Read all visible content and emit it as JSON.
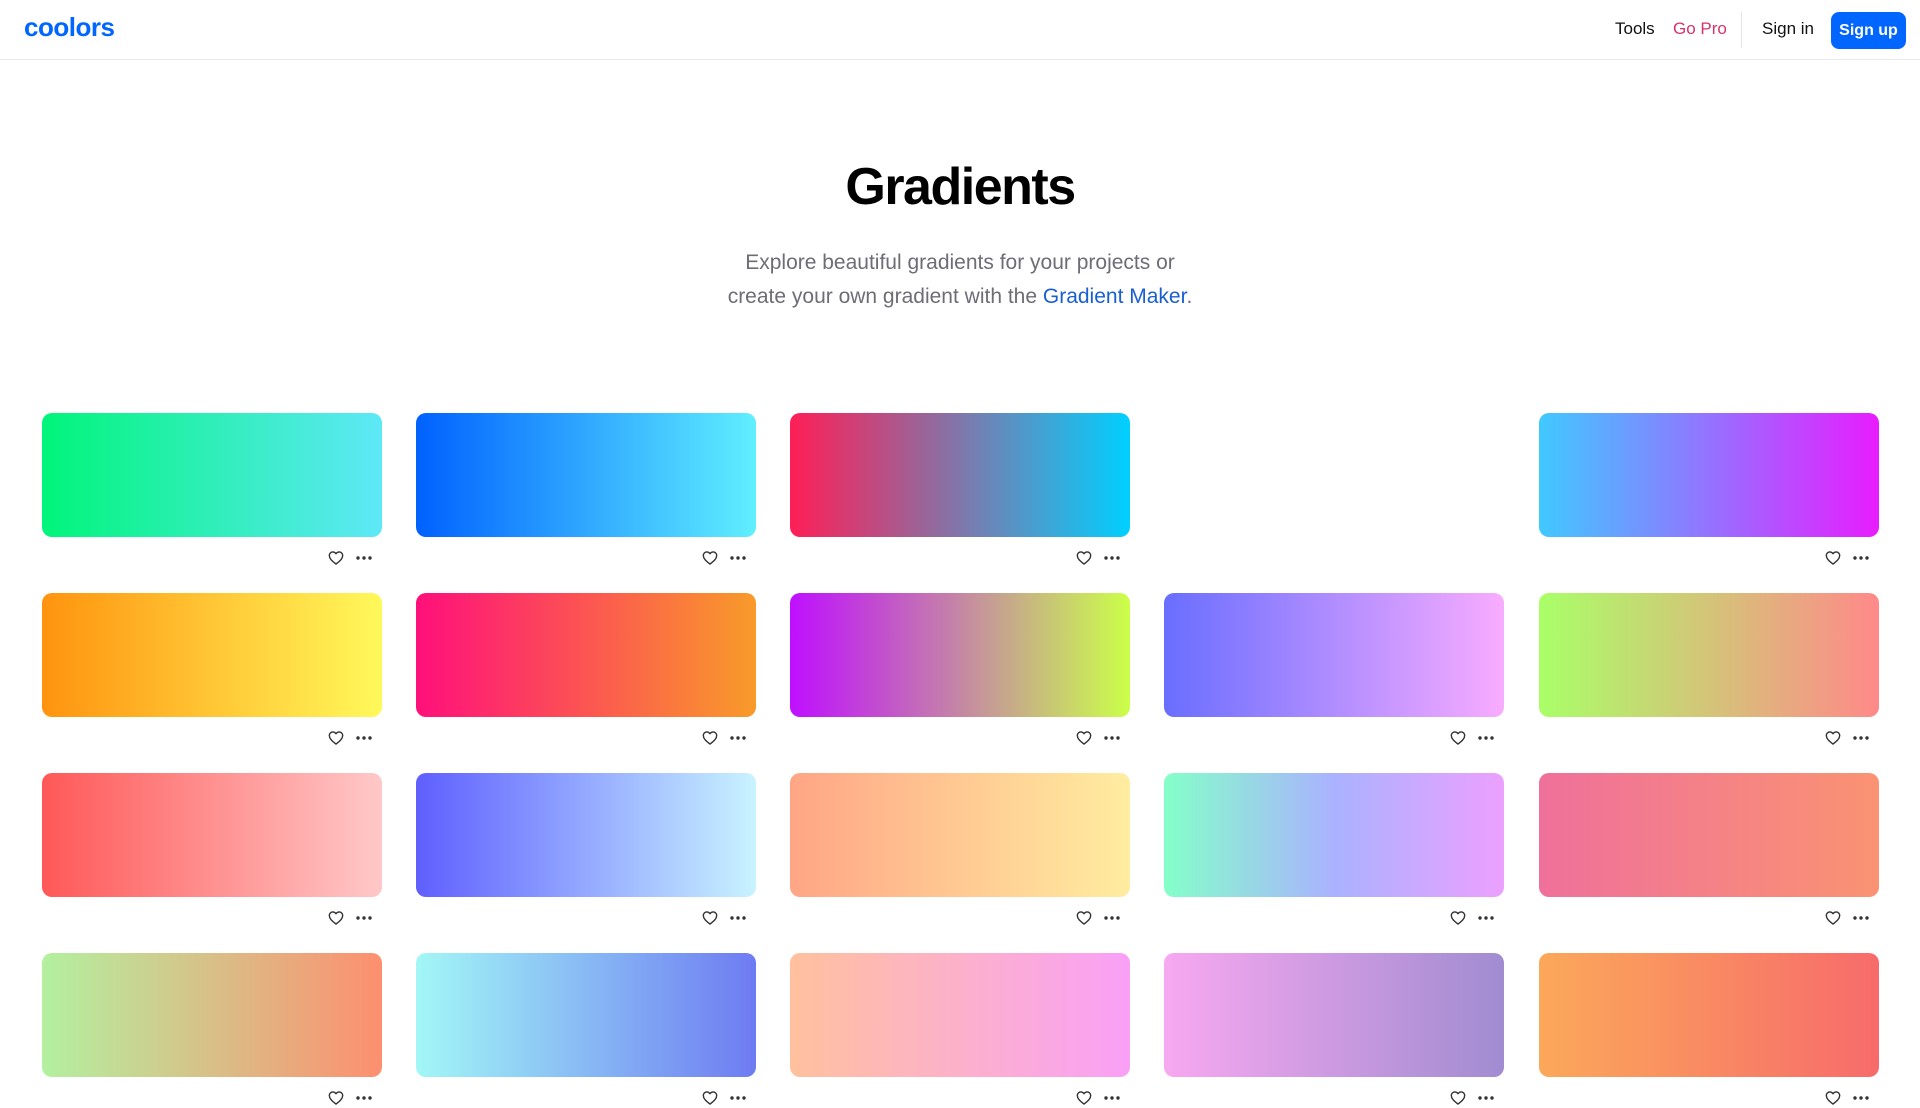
{
  "header": {
    "logo": "coolors",
    "nav": {
      "tools": "Tools",
      "go_pro": "Go Pro",
      "sign_in": "Sign in",
      "sign_up": "Sign up"
    }
  },
  "hero": {
    "title": "Gradients",
    "subtitle_line1": "Explore beautiful gradients for your projects or",
    "subtitle_line2_prefix": "create your own gradient with the ",
    "subtitle_link": "Gradient Maker",
    "subtitle_line2_suffix": "."
  },
  "gradients": [
    {
      "colors": [
        "#00f57a",
        "#5ee8f7"
      ]
    },
    {
      "colors": [
        "#0061ff",
        "#60efff"
      ]
    },
    {
      "colors": [
        "#ff1e56",
        "#00d0ff"
      ]
    },
    null,
    {
      "colors": [
        "#40c9ff",
        "#e81cff"
      ]
    },
    {
      "colors": [
        "#ff930f",
        "#fff95b"
      ]
    },
    {
      "colors": [
        "#ff0f7b",
        "#f89b29"
      ]
    },
    {
      "colors": [
        "#bf0fff",
        "#cbff49"
      ]
    },
    {
      "colors": [
        "#696eff",
        "#f8acff"
      ]
    },
    {
      "colors": [
        "#a9ff68",
        "#ff8989"
      ]
    },
    {
      "colors": [
        "#ff5858",
        "#ffc8c8"
      ]
    },
    {
      "colors": [
        "#5f5fff",
        "#c9f3ff"
      ]
    },
    {
      "colors": [
        "#ffa585",
        "#ffeda0"
      ]
    },
    {
      "colors": [
        "#84ffc9",
        "#aab2ff",
        "#eca0ff"
      ]
    },
    {
      "colors": [
        "#ef709b",
        "#fa9372"
      ]
    },
    {
      "colors": [
        "#b3f0a0",
        "#fd8f6f"
      ]
    },
    {
      "colors": [
        "#a2f7f6",
        "#6e7bf2"
      ]
    },
    {
      "colors": [
        "#ffc19e",
        "#f9a0f7"
      ]
    },
    {
      "colors": [
        "#f7a8f0",
        "#a18cd1"
      ]
    },
    {
      "colors": [
        "#fba85a",
        "#f76b6b"
      ]
    }
  ],
  "icons": {
    "like": "heart-icon",
    "more": "more-icon"
  }
}
